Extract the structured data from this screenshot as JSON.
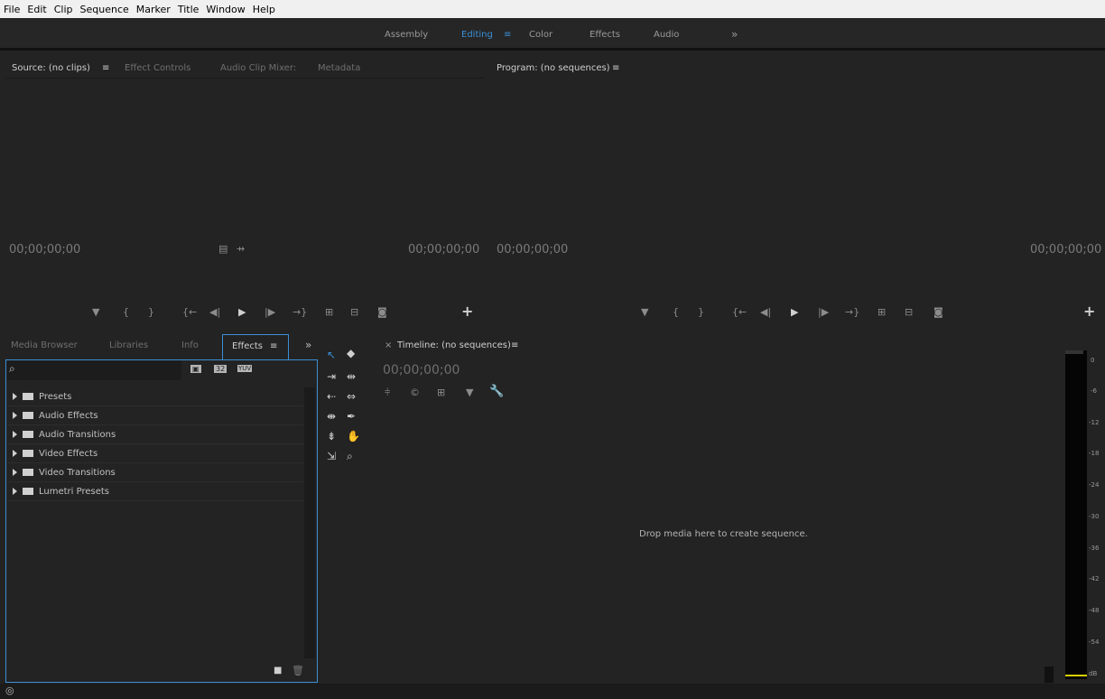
{
  "menu": [
    "File",
    "Edit",
    "Clip",
    "Sequence",
    "Marker",
    "Title",
    "Window",
    "Help"
  ],
  "workspaces": {
    "assembly": "Assembly",
    "editing": "Editing",
    "menu_icon": "≡",
    "color": "Color",
    "effects": "Effects",
    "audio": "Audio",
    "more": "»"
  },
  "source": {
    "tabs": [
      "Source: (no clips)",
      "≡",
      "Effect Controls",
      "Audio Clip Mixer:",
      "Metadata"
    ],
    "tc_left": "00;00;00;00",
    "tc_right": "00;00;00;00"
  },
  "program": {
    "tab": "Program: (no sequences)",
    "menu": "≡",
    "tc_left": "00;00;00;00",
    "tc_right": "00;00;00;00"
  },
  "transport": {
    "marker": "▼",
    "in": "{",
    "out": "}",
    "goin": "{←",
    "stepback": "◀|",
    "play": "▶",
    "stepfwd": "|▶",
    "goout": "→}",
    "insert": "⊞",
    "overwrite": "⊟",
    "export": "◙",
    "add": "+"
  },
  "project": {
    "tabs": [
      "Media Browser",
      "Libraries",
      "Info",
      "Effects",
      "≡"
    ],
    "more": "»",
    "badges": [
      "32",
      "YUV"
    ]
  },
  "effects_tree": [
    "Presets",
    "Audio Effects",
    "Audio Transitions",
    "Video Effects",
    "Video Transitions",
    "Lumetri Presets"
  ],
  "timeline": {
    "close": "×",
    "tab": "Timeline: (no sequences)",
    "menu": "≡",
    "tc": "00;00;00;00",
    "drop": "Drop media here to create sequence."
  },
  "meter": {
    "labels": [
      "0",
      "-6",
      "-12",
      "-18",
      "-24",
      "-30",
      "-36",
      "-42",
      "-48",
      "-54",
      "dB"
    ]
  },
  "colors": {
    "accent": "#3b8fd5",
    "meter_yellow": "#d8d000"
  }
}
